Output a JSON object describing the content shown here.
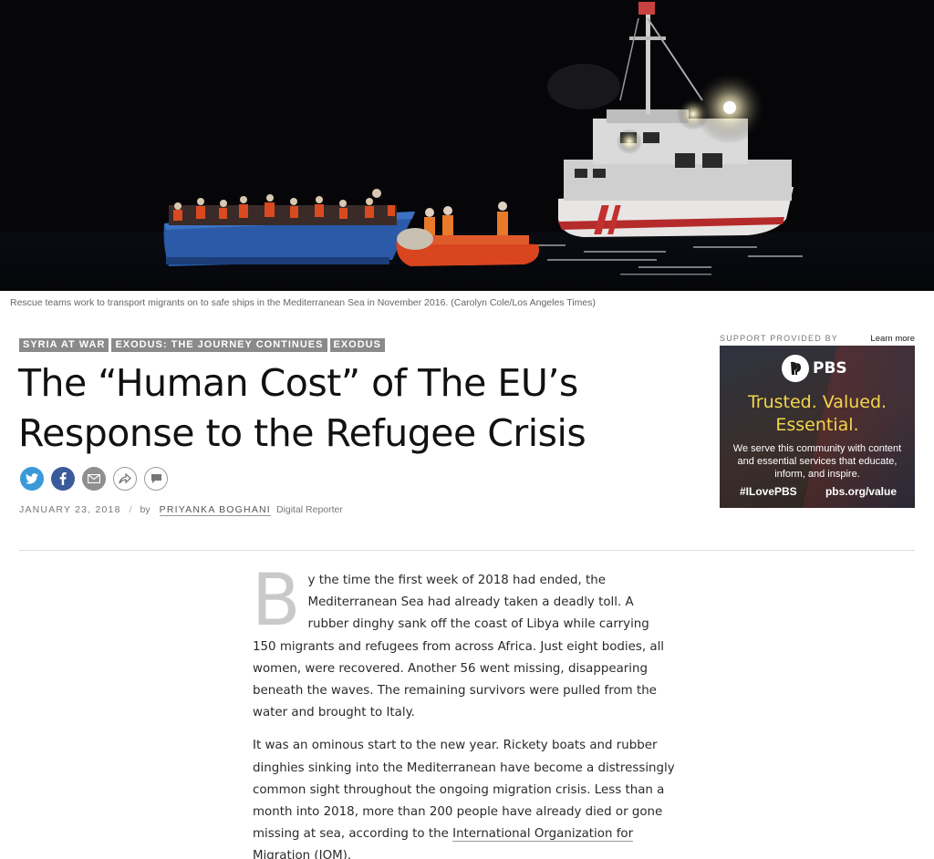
{
  "hero": {
    "caption": "Rescue teams work to transport migrants on to safe ships in the Mediterranean Sea in November 2016. (Carolyn Cole/Los Angeles Times)"
  },
  "tags": [
    "SYRIA AT WAR",
    "EXODUS: THE JOURNEY CONTINUES",
    "EXODUS"
  ],
  "headline": {
    "line1": "The “Human Cost” of The EU’s",
    "line2": "Response to the Refugee Crisis"
  },
  "share": {
    "icons": [
      "twitter-icon",
      "facebook-icon",
      "email-icon",
      "share-icon",
      "comment-icon"
    ]
  },
  "byline": {
    "date": "JANUARY 23, 2018",
    "separator": "/",
    "by": "by",
    "author": "PRIYANKA BOGHANI",
    "role": "Digital Reporter"
  },
  "ad": {
    "support_label": "SUPPORT PROVIDED BY",
    "learn_more": "Learn more",
    "logo_text": "PBS",
    "tagline_1": "Trusted. Valued.",
    "tagline_2": "Essential.",
    "body": "We serve this community with content and essential services that educate, inform, and inspire.",
    "hashtag": "#ILovePBS",
    "url": "pbs.org/value"
  },
  "article": {
    "dropcap": "B",
    "p1": "y the time the first week of 2018 had ended, the Mediterranean Sea had already taken a deadly toll. A rubber dinghy sank off the coast of Libya while carrying 150 migrants and refugees from across Africa. Just eight bodies, all women, were recovered. Another 56 went missing, disappearing beneath the waves. The remaining survivors were pulled from the water and brought to Italy.",
    "p2_text": "It was an ominous start to the new year. Rickety boats and rubber dinghies sinking into the Mediterranean have become a distressingly common sight throughout the ongoing migration crisis. Less than a month into 2018, more than 200 people have already died or gone missing at sea, according to the ",
    "p2_link": "International Organization for Migration (IOM)",
    "p2_end": "."
  }
}
